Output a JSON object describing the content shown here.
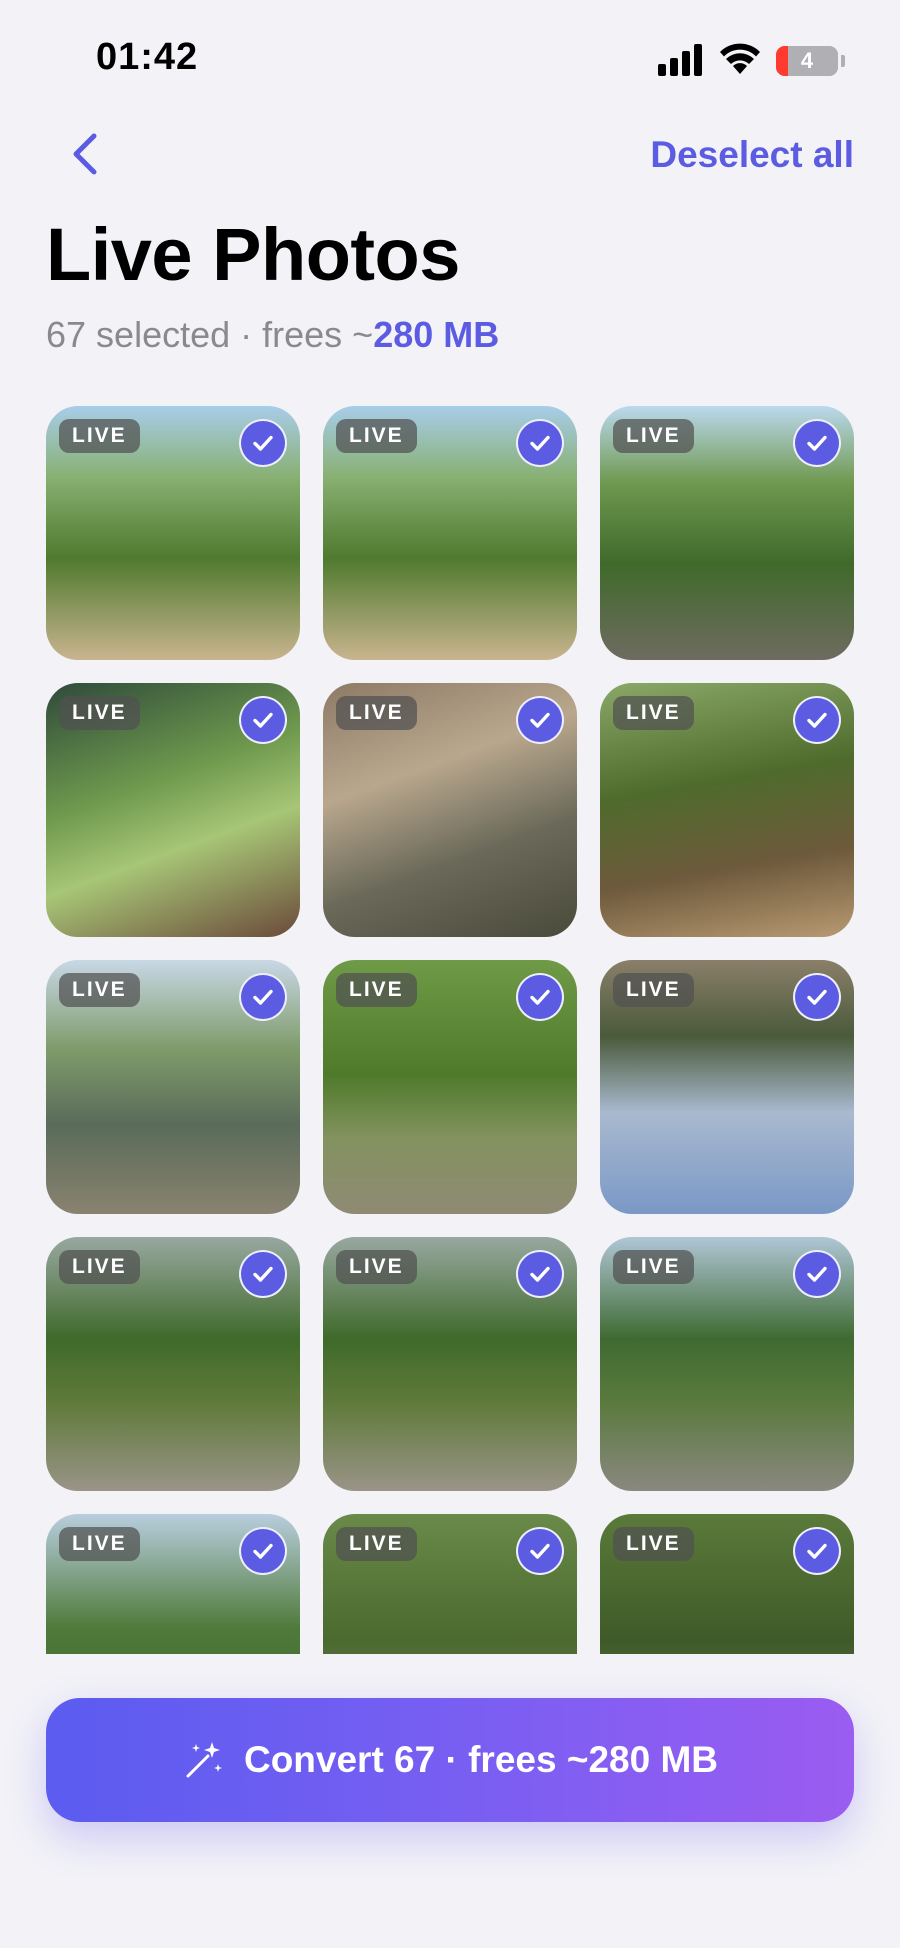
{
  "status_bar": {
    "time": "01:42",
    "battery_level": "4"
  },
  "nav": {
    "back_icon": "chevron-left-icon",
    "deselect_label": "Deselect all"
  },
  "header": {
    "title": "Live Photos",
    "subtitle_prefix": "67 selected · frees ~",
    "subtitle_size": "280 MB"
  },
  "photos": [
    {
      "badge": "LIVE",
      "selected": true
    },
    {
      "badge": "LIVE",
      "selected": true
    },
    {
      "badge": "LIVE",
      "selected": true
    },
    {
      "badge": "LIVE",
      "selected": true
    },
    {
      "badge": "LIVE",
      "selected": true
    },
    {
      "badge": "LIVE",
      "selected": true
    },
    {
      "badge": "LIVE",
      "selected": true
    },
    {
      "badge": "LIVE",
      "selected": true
    },
    {
      "badge": "LIVE",
      "selected": true
    },
    {
      "badge": "LIVE",
      "selected": true
    },
    {
      "badge": "LIVE",
      "selected": true
    },
    {
      "badge": "LIVE",
      "selected": true
    },
    {
      "badge": "LIVE",
      "selected": true
    },
    {
      "badge": "LIVE",
      "selected": true
    },
    {
      "badge": "LIVE",
      "selected": true
    }
  ],
  "convert_button": {
    "label": "Convert 67 · frees ~280 MB",
    "icon": "sparkles-icon"
  },
  "colors": {
    "accent": "#5b5ce2",
    "background": "#f2f2f7",
    "button_start": "#5b5cf0",
    "button_end": "#9b5cf1"
  }
}
